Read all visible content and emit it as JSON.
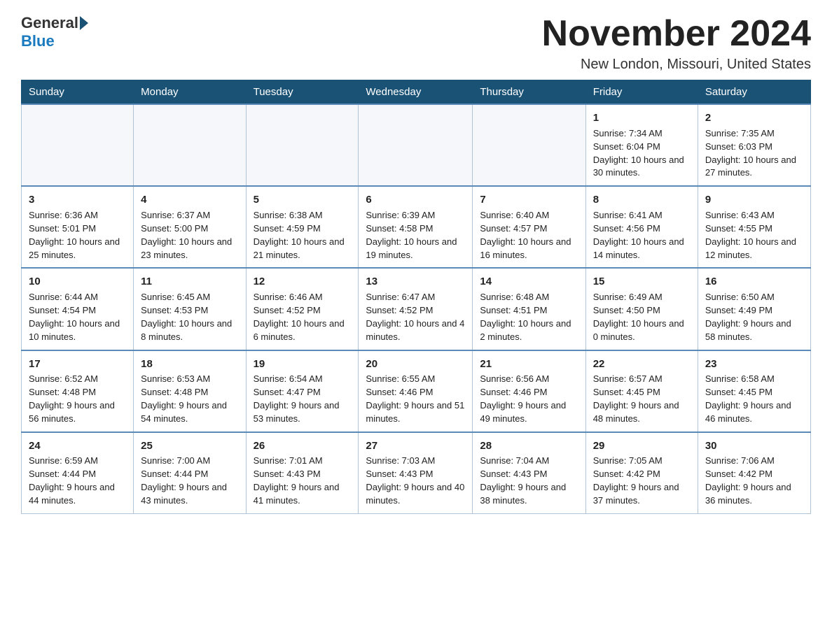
{
  "header": {
    "logo": {
      "general": "General",
      "blue": "Blue"
    },
    "title": "November 2024",
    "location": "New London, Missouri, United States"
  },
  "days_of_week": [
    "Sunday",
    "Monday",
    "Tuesday",
    "Wednesday",
    "Thursday",
    "Friday",
    "Saturday"
  ],
  "weeks": [
    [
      {
        "day": "",
        "info": ""
      },
      {
        "day": "",
        "info": ""
      },
      {
        "day": "",
        "info": ""
      },
      {
        "day": "",
        "info": ""
      },
      {
        "day": "",
        "info": ""
      },
      {
        "day": "1",
        "info": "Sunrise: 7:34 AM\nSunset: 6:04 PM\nDaylight: 10 hours and 30 minutes."
      },
      {
        "day": "2",
        "info": "Sunrise: 7:35 AM\nSunset: 6:03 PM\nDaylight: 10 hours and 27 minutes."
      }
    ],
    [
      {
        "day": "3",
        "info": "Sunrise: 6:36 AM\nSunset: 5:01 PM\nDaylight: 10 hours and 25 minutes."
      },
      {
        "day": "4",
        "info": "Sunrise: 6:37 AM\nSunset: 5:00 PM\nDaylight: 10 hours and 23 minutes."
      },
      {
        "day": "5",
        "info": "Sunrise: 6:38 AM\nSunset: 4:59 PM\nDaylight: 10 hours and 21 minutes."
      },
      {
        "day": "6",
        "info": "Sunrise: 6:39 AM\nSunset: 4:58 PM\nDaylight: 10 hours and 19 minutes."
      },
      {
        "day": "7",
        "info": "Sunrise: 6:40 AM\nSunset: 4:57 PM\nDaylight: 10 hours and 16 minutes."
      },
      {
        "day": "8",
        "info": "Sunrise: 6:41 AM\nSunset: 4:56 PM\nDaylight: 10 hours and 14 minutes."
      },
      {
        "day": "9",
        "info": "Sunrise: 6:43 AM\nSunset: 4:55 PM\nDaylight: 10 hours and 12 minutes."
      }
    ],
    [
      {
        "day": "10",
        "info": "Sunrise: 6:44 AM\nSunset: 4:54 PM\nDaylight: 10 hours and 10 minutes."
      },
      {
        "day": "11",
        "info": "Sunrise: 6:45 AM\nSunset: 4:53 PM\nDaylight: 10 hours and 8 minutes."
      },
      {
        "day": "12",
        "info": "Sunrise: 6:46 AM\nSunset: 4:52 PM\nDaylight: 10 hours and 6 minutes."
      },
      {
        "day": "13",
        "info": "Sunrise: 6:47 AM\nSunset: 4:52 PM\nDaylight: 10 hours and 4 minutes."
      },
      {
        "day": "14",
        "info": "Sunrise: 6:48 AM\nSunset: 4:51 PM\nDaylight: 10 hours and 2 minutes."
      },
      {
        "day": "15",
        "info": "Sunrise: 6:49 AM\nSunset: 4:50 PM\nDaylight: 10 hours and 0 minutes."
      },
      {
        "day": "16",
        "info": "Sunrise: 6:50 AM\nSunset: 4:49 PM\nDaylight: 9 hours and 58 minutes."
      }
    ],
    [
      {
        "day": "17",
        "info": "Sunrise: 6:52 AM\nSunset: 4:48 PM\nDaylight: 9 hours and 56 minutes."
      },
      {
        "day": "18",
        "info": "Sunrise: 6:53 AM\nSunset: 4:48 PM\nDaylight: 9 hours and 54 minutes."
      },
      {
        "day": "19",
        "info": "Sunrise: 6:54 AM\nSunset: 4:47 PM\nDaylight: 9 hours and 53 minutes."
      },
      {
        "day": "20",
        "info": "Sunrise: 6:55 AM\nSunset: 4:46 PM\nDaylight: 9 hours and 51 minutes."
      },
      {
        "day": "21",
        "info": "Sunrise: 6:56 AM\nSunset: 4:46 PM\nDaylight: 9 hours and 49 minutes."
      },
      {
        "day": "22",
        "info": "Sunrise: 6:57 AM\nSunset: 4:45 PM\nDaylight: 9 hours and 48 minutes."
      },
      {
        "day": "23",
        "info": "Sunrise: 6:58 AM\nSunset: 4:45 PM\nDaylight: 9 hours and 46 minutes."
      }
    ],
    [
      {
        "day": "24",
        "info": "Sunrise: 6:59 AM\nSunset: 4:44 PM\nDaylight: 9 hours and 44 minutes."
      },
      {
        "day": "25",
        "info": "Sunrise: 7:00 AM\nSunset: 4:44 PM\nDaylight: 9 hours and 43 minutes."
      },
      {
        "day": "26",
        "info": "Sunrise: 7:01 AM\nSunset: 4:43 PM\nDaylight: 9 hours and 41 minutes."
      },
      {
        "day": "27",
        "info": "Sunrise: 7:03 AM\nSunset: 4:43 PM\nDaylight: 9 hours and 40 minutes."
      },
      {
        "day": "28",
        "info": "Sunrise: 7:04 AM\nSunset: 4:43 PM\nDaylight: 9 hours and 38 minutes."
      },
      {
        "day": "29",
        "info": "Sunrise: 7:05 AM\nSunset: 4:42 PM\nDaylight: 9 hours and 37 minutes."
      },
      {
        "day": "30",
        "info": "Sunrise: 7:06 AM\nSunset: 4:42 PM\nDaylight: 9 hours and 36 minutes."
      }
    ]
  ]
}
